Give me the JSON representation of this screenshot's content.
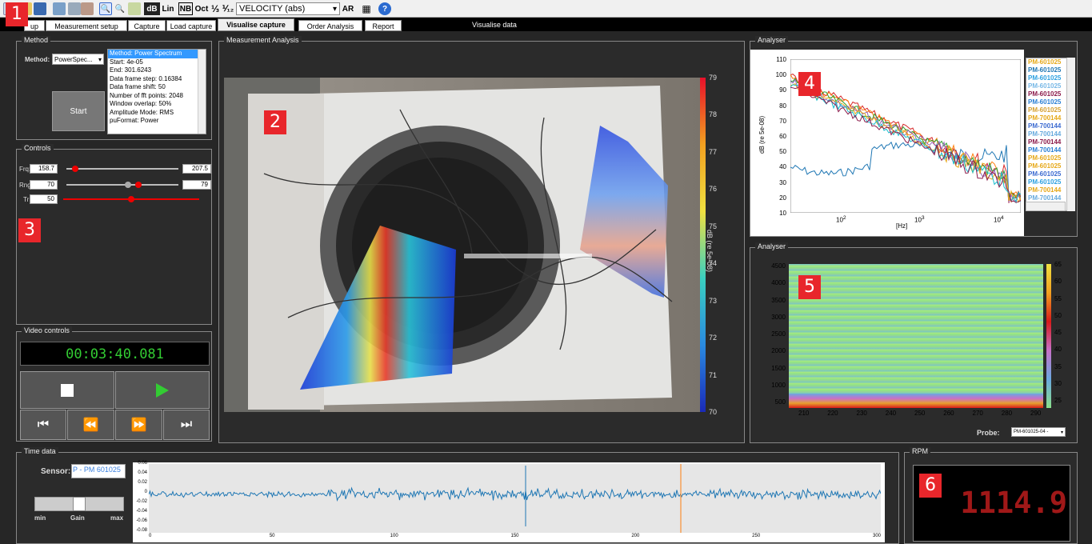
{
  "toolbar": {
    "db": "dB",
    "lin": "Lin",
    "nb": "NB",
    "oct": "Oct",
    "third": "⅓",
    "twelfth": "⅟₁₂",
    "quantity": "VELOCITY (abs)",
    "ar": "AR",
    "help": "?"
  },
  "tabs": [
    {
      "label": "up"
    },
    {
      "label": "Measurement setup"
    },
    {
      "label": "Capture"
    },
    {
      "label": "Load capture"
    },
    {
      "label": "Visualise capture"
    },
    {
      "label": "Order Analysis"
    },
    {
      "label": "Report"
    }
  ],
  "visualise_data": "Visualise data",
  "method": {
    "title": "Method",
    "label": "Method:",
    "value": "PowerSpec...",
    "start": "Start",
    "info": [
      "Method: Power Spectrum",
      "Start: 4e-05",
      "End: 301.6243",
      "Data frame step: 0.16384",
      "Data frame shift: 50",
      "Number of fft points: 2048",
      "Window overlap: 50%",
      "Amplitude Mode: RMS",
      "puFormat: Power"
    ]
  },
  "controls": {
    "title": "Controls",
    "frq_label": "Frq:",
    "frq_min": "158.7",
    "frq_max": "207.5",
    "frq_level": 0.05,
    "rng_label": "Rng:",
    "rng_min": "70",
    "rng_max": "79",
    "rng_lo": 0.55,
    "rng_hi": 0.65,
    "tr_label": "Tr:",
    "tr_value": "50",
    "tr_level": 0.5
  },
  "video": {
    "title": "Video controls",
    "time": "00:03:40.081"
  },
  "measurement": {
    "title": "Measurement Analysis",
    "colorbar_label": "dB (re 5e-08)",
    "colorbar_ticks": [
      "79",
      "78",
      "77",
      "76",
      "75",
      "74",
      "73",
      "72",
      "71",
      "70"
    ]
  },
  "analyser1": {
    "title": "Analyser",
    "ylabel": "dB (re 5e-08)",
    "xlabel": "[Hz]",
    "yticks": [
      "110",
      "100",
      "90",
      "80",
      "70",
      "60",
      "50",
      "40",
      "30",
      "20",
      "10"
    ],
    "legend": [
      {
        "name": "PM-601025",
        "color": "#e6a817"
      },
      {
        "name": "PM-601025",
        "color": "#1f77b4"
      },
      {
        "name": "PM-601025",
        "color": "#2ca0e0"
      },
      {
        "name": "PM-601025",
        "color": "#77b8e6"
      },
      {
        "name": "PM-601025",
        "color": "#8b1a4a"
      },
      {
        "name": "PM-601025",
        "color": "#2a7fd4"
      },
      {
        "name": "PM-601025",
        "color": "#d6a030"
      },
      {
        "name": "PM-700144",
        "color": "#e6a817"
      },
      {
        "name": "PM-700144",
        "color": "#3b6ad0"
      },
      {
        "name": "PM-700144",
        "color": "#66aadd"
      },
      {
        "name": "PM-700144",
        "color": "#8b1a4a"
      },
      {
        "name": "PM-700144",
        "color": "#2a7fd4"
      },
      {
        "name": "PM-601025",
        "color": "#e6a817"
      },
      {
        "name": "PM-601025",
        "color": "#e6a817"
      },
      {
        "name": "PM-601025",
        "color": "#3b6ad0"
      },
      {
        "name": "PM-601025",
        "color": "#2ca0e0"
      },
      {
        "name": "PM-700144",
        "color": "#e6a817"
      },
      {
        "name": "PM-700144",
        "color": "#66aadd"
      }
    ]
  },
  "analyser2": {
    "title": "Analyser",
    "yticks": [
      "4500",
      "4000",
      "3500",
      "3000",
      "2500",
      "2000",
      "1500",
      "1000",
      "500"
    ],
    "xticks": [
      "210",
      "220",
      "230",
      "240",
      "250",
      "260",
      "270",
      "280",
      "290"
    ],
    "cticks": [
      "65",
      "60",
      "55",
      "50",
      "45",
      "40",
      "35",
      "30",
      "25"
    ],
    "probe_label": "Probe:",
    "probe_value": "PM-601025-04 -"
  },
  "timedata": {
    "title": "Time data",
    "sensor_label": "Sensor:",
    "sensor_value": "P - PM 601025",
    "gain": "Gain",
    "min": "min",
    "max": "max",
    "gain_level": 0.5,
    "yticks": [
      "0.06",
      "0.04",
      "0.02",
      "0",
      "-0.02",
      "-0.04",
      "-0.06",
      "-0.08"
    ],
    "xticks": [
      "0",
      "50",
      "100",
      "150",
      "200",
      "250",
      "300"
    ]
  },
  "rpm": {
    "title": "RPM",
    "value": "1114.9"
  },
  "badges": [
    "1",
    "2",
    "3",
    "4",
    "5",
    "6"
  ]
}
